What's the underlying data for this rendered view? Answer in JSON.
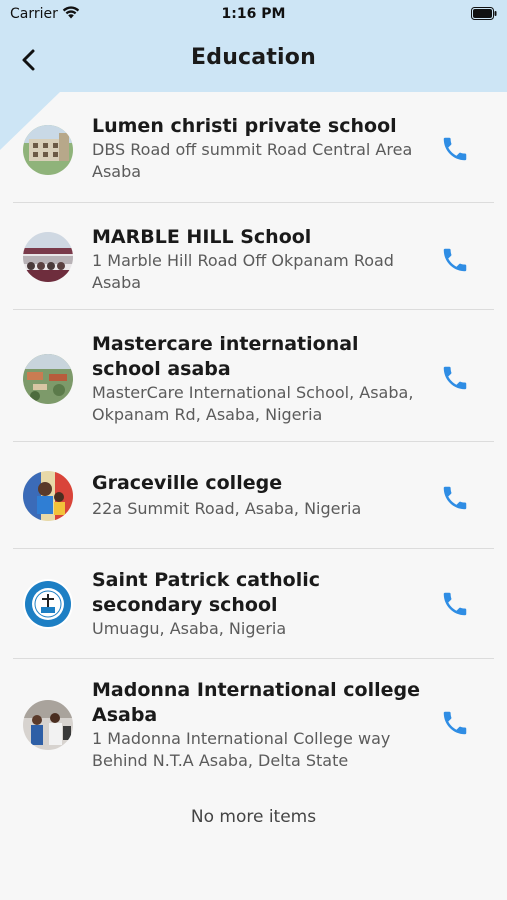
{
  "status_bar": {
    "carrier": "Carrier",
    "time": "1:16 PM"
  },
  "nav": {
    "title": "Education"
  },
  "schools": [
    {
      "name": "Lumen christi private school",
      "address": "DBS Road off summit Road Central Area Asaba"
    },
    {
      "name": "MARBLE HILL School",
      "address": "1 Marble Hill Road Off Okpanam Road Asaba"
    },
    {
      "name": "Mastercare international school asaba",
      "address": "MasterCare International School, Asaba, Okpanam Rd, Asaba, Nigeria"
    },
    {
      "name": "Graceville college",
      "address": "22a Summit Road, Asaba, Nigeria"
    },
    {
      "name": "Saint Patrick catholic secondary school",
      "address": "Umuagu, Asaba, Nigeria"
    },
    {
      "name": "Madonna International college Asaba",
      "address": "1 Madonna International College way Behind N.T.A Asaba, Delta State"
    }
  ],
  "footer": {
    "message": "No more items"
  },
  "colors": {
    "accent": "#2f8de4",
    "header_bg": "#cde5f5"
  }
}
